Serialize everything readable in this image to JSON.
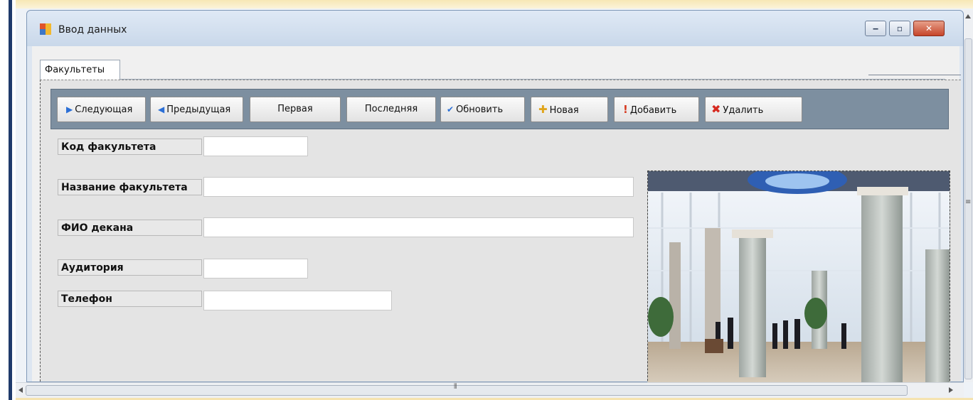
{
  "window": {
    "title": "Ввод данных",
    "controls": {
      "minimize": "‒",
      "maximize": "▫",
      "close": "✕"
    }
  },
  "tabs": [
    {
      "label": "Факультеты"
    }
  ],
  "toolbar": {
    "buttons": [
      {
        "label": "Следующая",
        "icon": "triangle-right-icon",
        "glyph": "▶",
        "color": "#2b6fd6"
      },
      {
        "label": "Предыдущая",
        "icon": "triangle-left-icon",
        "glyph": "◀",
        "color": "#2b6fd6"
      },
      {
        "label": "Первая"
      },
      {
        "label": "Последняя"
      },
      {
        "label": "Обновить",
        "icon": "checkmark-icon",
        "glyph": "✔",
        "color": "#2b6fd6"
      },
      {
        "label": "Новая",
        "icon": "plus-icon",
        "glyph": "✚",
        "color": "#e0a51c"
      },
      {
        "label": "Добавить",
        "icon": "exclamation-icon",
        "glyph": "!",
        "color": "#d6391f"
      },
      {
        "label": "Удалить",
        "icon": "delete-x-icon",
        "glyph": "✖",
        "color": "#d6291f"
      }
    ]
  },
  "form": {
    "fields": [
      {
        "label": "Код факультета",
        "value": ""
      },
      {
        "label": "Название факультета",
        "value": ""
      },
      {
        "label": "ФИО декана",
        "value": ""
      },
      {
        "label": "Аудитория",
        "value": ""
      },
      {
        "label": "Телефон",
        "value": ""
      }
    ]
  },
  "colors": {
    "toolbar": "#7d8fa0",
    "panel": "#e4e4e4",
    "close_button": "#c6452a"
  }
}
